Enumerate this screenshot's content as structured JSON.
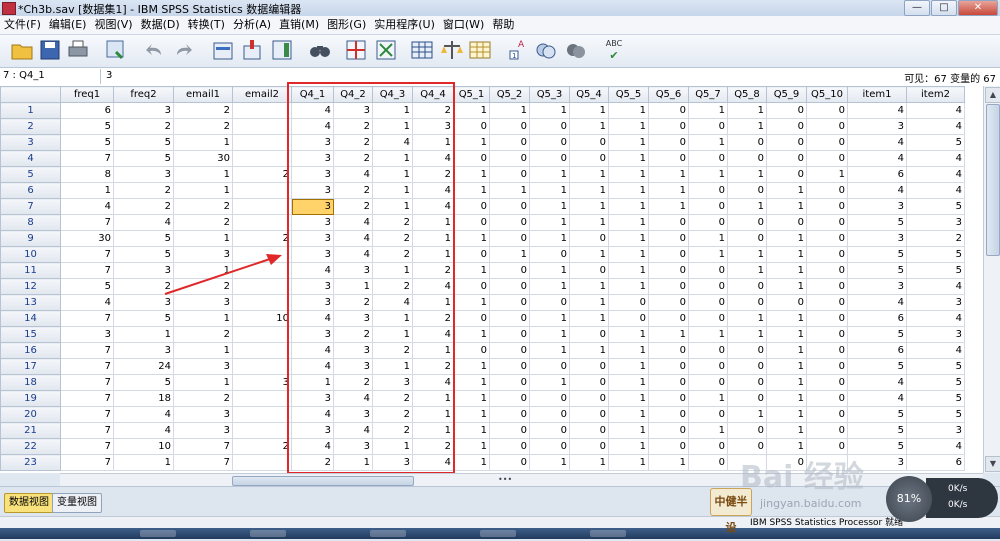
{
  "window": {
    "title": "*Ch3b.sav [数据集1] - IBM SPSS Statistics 数据编辑器",
    "min": "—",
    "max": "□",
    "close": "✕"
  },
  "menu": [
    "文件(F)",
    "编辑(E)",
    "视图(V)",
    "数据(D)",
    "转换(T)",
    "分析(A)",
    "直销(M)",
    "图形(G)",
    "实用程序(U)",
    "窗口(W)",
    "帮助"
  ],
  "toolbar": {
    "icons": [
      "open-folder-icon",
      "save-icon",
      "print-icon",
      "recall-dialog-icon",
      "undo-icon",
      "redo-icon",
      "goto-case-icon",
      "goto-variable-icon",
      "variables-icon",
      "find-icon",
      "insert-cases-icon",
      "insert-variable-icon",
      "split-file-icon",
      "weight-cases-icon",
      "select-cases-icon",
      "value-labels-icon",
      "use-sets-icon",
      "show-all-variables-icon",
      "spell-check-icon"
    ],
    "spell_label": "ABC"
  },
  "cellbar": {
    "ref": "7 : Q4_1",
    "value": "3",
    "visible": "可见：67 变量的 67"
  },
  "columns": [
    "freq1",
    "freq2",
    "email1",
    "email2",
    "Q4_1",
    "Q4_2",
    "Q4_3",
    "Q4_4",
    "Q5_1",
    "Q5_2",
    "Q5_3",
    "Q5_4",
    "Q5_5",
    "Q5_6",
    "Q5_7",
    "Q5_8",
    "Q5_9",
    "Q5_10",
    "item1",
    "item2"
  ],
  "rows": [
    [
      "6",
      "3",
      "2",
      "",
      "4",
      "3",
      "1",
      "2",
      "1",
      "1",
      "1",
      "1",
      "1",
      "0",
      "1",
      "1",
      "0",
      "0",
      "4",
      "4"
    ],
    [
      "5",
      "2",
      "2",
      "",
      "4",
      "2",
      "1",
      "3",
      "0",
      "0",
      "0",
      "1",
      "1",
      "0",
      "0",
      "1",
      "0",
      "0",
      "3",
      "4"
    ],
    [
      "5",
      "5",
      "1",
      "",
      "3",
      "2",
      "4",
      "1",
      "1",
      "0",
      "0",
      "0",
      "1",
      "0",
      "1",
      "0",
      "0",
      "0",
      "4",
      "5"
    ],
    [
      "7",
      "5",
      "30",
      "",
      "3",
      "2",
      "1",
      "4",
      "0",
      "0",
      "0",
      "0",
      "1",
      "0",
      "0",
      "0",
      "0",
      "0",
      "4",
      "4"
    ],
    [
      "8",
      "3",
      "1",
      "2",
      "3",
      "4",
      "1",
      "2",
      "1",
      "0",
      "1",
      "1",
      "1",
      "1",
      "1",
      "1",
      "0",
      "1",
      "6",
      "4"
    ],
    [
      "1",
      "2",
      "1",
      "",
      "3",
      "2",
      "1",
      "4",
      "1",
      "1",
      "1",
      "1",
      "1",
      "1",
      "0",
      "0",
      "1",
      "0",
      "4",
      "4"
    ],
    [
      "4",
      "2",
      "2",
      "",
      "3",
      "2",
      "1",
      "4",
      "0",
      "0",
      "1",
      "1",
      "1",
      "1",
      "0",
      "1",
      "1",
      "0",
      "3",
      "5"
    ],
    [
      "7",
      "4",
      "2",
      "",
      "3",
      "4",
      "2",
      "1",
      "0",
      "0",
      "1",
      "1",
      "1",
      "0",
      "0",
      "0",
      "0",
      "0",
      "5",
      "3"
    ],
    [
      "30",
      "5",
      "1",
      "2",
      "3",
      "4",
      "2",
      "1",
      "1",
      "0",
      "1",
      "0",
      "1",
      "0",
      "1",
      "0",
      "1",
      "0",
      "3",
      "2"
    ],
    [
      "7",
      "5",
      "3",
      "",
      "3",
      "4",
      "2",
      "1",
      "0",
      "1",
      "0",
      "1",
      "1",
      "0",
      "1",
      "1",
      "1",
      "0",
      "5",
      "5"
    ],
    [
      "7",
      "3",
      "1",
      "",
      "4",
      "3",
      "1",
      "2",
      "1",
      "0",
      "1",
      "0",
      "1",
      "0",
      "0",
      "1",
      "1",
      "0",
      "5",
      "5"
    ],
    [
      "5",
      "2",
      "2",
      "",
      "3",
      "1",
      "2",
      "4",
      "0",
      "0",
      "1",
      "1",
      "1",
      "0",
      "0",
      "0",
      "1",
      "0",
      "3",
      "4"
    ],
    [
      "4",
      "3",
      "3",
      "",
      "3",
      "2",
      "4",
      "1",
      "1",
      "0",
      "0",
      "1",
      "0",
      "0",
      "0",
      "0",
      "0",
      "0",
      "4",
      "3"
    ],
    [
      "7",
      "5",
      "1",
      "10",
      "4",
      "3",
      "1",
      "2",
      "0",
      "0",
      "1",
      "1",
      "0",
      "0",
      "0",
      "1",
      "1",
      "0",
      "6",
      "4"
    ],
    [
      "3",
      "1",
      "2",
      "",
      "3",
      "2",
      "1",
      "4",
      "1",
      "0",
      "1",
      "0",
      "1",
      "1",
      "1",
      "1",
      "1",
      "0",
      "5",
      "3"
    ],
    [
      "7",
      "3",
      "1",
      "",
      "4",
      "3",
      "2",
      "1",
      "0",
      "0",
      "1",
      "1",
      "1",
      "0",
      "0",
      "0",
      "1",
      "0",
      "6",
      "4"
    ],
    [
      "7",
      "24",
      "3",
      "",
      "4",
      "3",
      "1",
      "2",
      "1",
      "0",
      "0",
      "0",
      "1",
      "0",
      "0",
      "0",
      "1",
      "0",
      "5",
      "5"
    ],
    [
      "7",
      "5",
      "1",
      "3",
      "1",
      "2",
      "3",
      "4",
      "1",
      "0",
      "1",
      "0",
      "1",
      "0",
      "0",
      "0",
      "1",
      "0",
      "4",
      "5"
    ],
    [
      "7",
      "18",
      "2",
      "",
      "3",
      "4",
      "2",
      "1",
      "1",
      "0",
      "0",
      "0",
      "1",
      "0",
      "1",
      "0",
      "1",
      "0",
      "4",
      "5"
    ],
    [
      "7",
      "4",
      "3",
      "",
      "4",
      "3",
      "2",
      "1",
      "1",
      "0",
      "0",
      "0",
      "1",
      "0",
      "0",
      "1",
      "1",
      "0",
      "5",
      "5"
    ],
    [
      "7",
      "4",
      "3",
      "",
      "3",
      "4",
      "2",
      "1",
      "1",
      "0",
      "0",
      "0",
      "1",
      "0",
      "1",
      "0",
      "1",
      "0",
      "5",
      "3"
    ],
    [
      "7",
      "10",
      "7",
      "2",
      "4",
      "3",
      "1",
      "2",
      "1",
      "0",
      "0",
      "0",
      "1",
      "0",
      "0",
      "0",
      "1",
      "0",
      "5",
      "4"
    ],
    [
      "7",
      "1",
      "7",
      "",
      "2",
      "1",
      "3",
      "4",
      "1",
      "0",
      "1",
      "1",
      "1",
      "1",
      "0",
      "",
      "0",
      "",
      "3",
      "6"
    ]
  ],
  "selected": {
    "row": 7,
    "column": "Q4_1"
  },
  "tabs": {
    "data_view": "数据视图",
    "variable_view": "变量视图"
  },
  "status": {
    "processor": "IBM SPSS Statistics Processor 就绪"
  },
  "overlay": {
    "badge": "中健半设",
    "watermark": "Bai 经验",
    "watermark_url": "jingyan.baidu.com",
    "gauge": "81%",
    "net_up": "0K/s",
    "net_down": "0K/s"
  },
  "colors": {
    "highlight_box": "#e02828",
    "selected_cell": "#ffd36a",
    "active_tab": "#f9e27c"
  }
}
